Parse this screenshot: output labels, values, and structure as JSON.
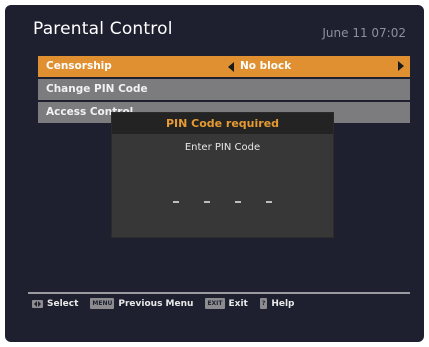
{
  "header": {
    "title": "Parental Control",
    "datetime": "June 11 07:02"
  },
  "menu": {
    "items": [
      {
        "label": "Censorship",
        "value": "No block"
      },
      {
        "label": "Change PIN Code"
      },
      {
        "label": "Access Control"
      }
    ]
  },
  "dialog": {
    "title": "PIN Code required",
    "prompt": "Enter PIN Code",
    "pin_slots": [
      "-",
      "-",
      "-",
      "-"
    ]
  },
  "footer": {
    "select_label": "Select",
    "menu_key": "MENU",
    "menu_label": "Previous Menu",
    "exit_key": "EXIT",
    "exit_label": "Exit",
    "help_key": "?",
    "help_label": "Help"
  },
  "colors": {
    "accent": "#e09030",
    "background": "#1e2030",
    "row": "#7c7c7f"
  },
  "icons": {
    "left_arrow": "arrow-left-icon",
    "right_arrow": "arrow-right-icon",
    "nav": "left-right-keys-icon"
  }
}
